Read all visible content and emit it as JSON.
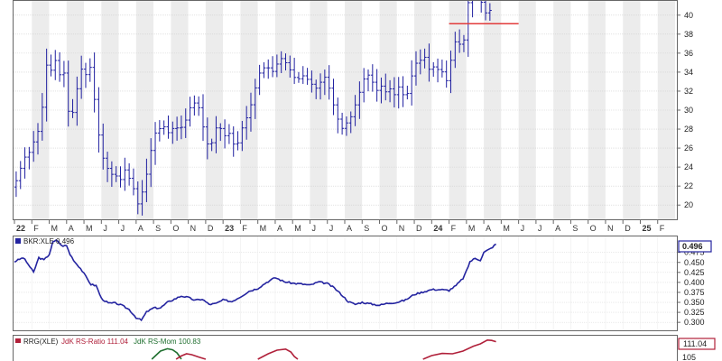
{
  "chart_data": [
    {
      "panel": "price",
      "type": "ohlc",
      "xlabel": "",
      "ylabel": "",
      "ylim": [
        18.5,
        41.5
      ],
      "y_ticks": [
        "20",
        "22",
        "24",
        "26",
        "28",
        "30",
        "32",
        "34",
        "36",
        "38",
        "40"
      ],
      "grid": true,
      "month_labels": [
        "22",
        "F",
        "M",
        "A",
        "M",
        "J",
        "J",
        "A",
        "S",
        "O",
        "N",
        "D",
        "23",
        "F",
        "M",
        "A",
        "M",
        "J",
        "J",
        "A",
        "S",
        "O",
        "N",
        "D",
        "24",
        "F",
        "M",
        "A",
        "M",
        "J",
        "J",
        "A",
        "S",
        "O",
        "N",
        "D",
        "25",
        "F"
      ],
      "bold_labels": [
        "22",
        "23",
        "24",
        "25"
      ],
      "x_range_months": [
        0,
        38
      ],
      "series_keypoints": [
        [
          0.1,
          21.9
        ],
        [
          0.4,
          23.5
        ],
        [
          0.7,
          25.0
        ],
        [
          1.0,
          25.6
        ],
        [
          1.3,
          27.0
        ],
        [
          1.6,
          28.3
        ],
        [
          1.8,
          31.5
        ],
        [
          2.0,
          35.2
        ],
        [
          2.2,
          34.0
        ],
        [
          2.4,
          35.6
        ],
        [
          2.6,
          34.6
        ],
        [
          2.8,
          33.2
        ],
        [
          3.0,
          34.0
        ],
        [
          3.2,
          30.0
        ],
        [
          3.4,
          29.0
        ],
        [
          3.6,
          31.0
        ],
        [
          3.8,
          33.0
        ],
        [
          4.0,
          34.5
        ],
        [
          4.2,
          33.5
        ],
        [
          4.4,
          35.4
        ],
        [
          4.6,
          33.0
        ],
        [
          4.8,
          30.0
        ],
        [
          5.0,
          27.0
        ],
        [
          5.2,
          25.0
        ],
        [
          5.4,
          24.5
        ],
        [
          5.6,
          22.8
        ],
        [
          5.8,
          23.5
        ],
        [
          6.0,
          23.0
        ],
        [
          6.2,
          22.5
        ],
        [
          6.4,
          24.0
        ],
        [
          6.6,
          23.2
        ],
        [
          6.8,
          22.6
        ],
        [
          7.0,
          21.6
        ],
        [
          7.2,
          20.0
        ],
        [
          7.4,
          21.0
        ],
        [
          7.6,
          22.0
        ],
        [
          7.8,
          24.0
        ],
        [
          8.0,
          26.0
        ],
        [
          8.2,
          27.5
        ],
        [
          8.4,
          28.2
        ],
        [
          8.6,
          27.8
        ],
        [
          8.8,
          28.5
        ],
        [
          9.0,
          27.5
        ],
        [
          9.2,
          28.0
        ],
        [
          9.4,
          28.5
        ],
        [
          9.6,
          27.5
        ],
        [
          9.8,
          28.6
        ],
        [
          10.0,
          29.0
        ],
        [
          10.2,
          30.2
        ],
        [
          10.4,
          30.6
        ],
        [
          10.6,
          31.0
        ],
        [
          10.8,
          29.8
        ],
        [
          11.0,
          28.0
        ],
        [
          11.2,
          26.5
        ],
        [
          11.4,
          26.0
        ],
        [
          11.6,
          27.5
        ],
        [
          11.8,
          28.5
        ],
        [
          12.0,
          28.0
        ],
        [
          12.2,
          27.2
        ],
        [
          12.4,
          28.0
        ],
        [
          12.6,
          26.8
        ],
        [
          12.8,
          26.2
        ],
        [
          13.0,
          26.6
        ],
        [
          13.2,
          28.0
        ],
        [
          13.4,
          29.0
        ],
        [
          13.6,
          29.5
        ],
        [
          13.8,
          31.2
        ],
        [
          14.0,
          32.5
        ],
        [
          14.2,
          33.8
        ],
        [
          14.4,
          34.6
        ],
        [
          14.6,
          34.2
        ],
        [
          14.8,
          34.6
        ],
        [
          15.0,
          34.0
        ],
        [
          15.2,
          34.8
        ],
        [
          15.4,
          35.2
        ],
        [
          15.6,
          35.8
        ],
        [
          15.8,
          34.5
        ],
        [
          16.0,
          34.2
        ],
        [
          16.2,
          33.5
        ],
        [
          16.4,
          33.0
        ],
        [
          16.6,
          33.8
        ],
        [
          16.8,
          33.5
        ],
        [
          17.0,
          33.2
        ],
        [
          17.2,
          32.8
        ],
        [
          17.4,
          32.2
        ],
        [
          17.6,
          32.5
        ],
        [
          17.8,
          33.2
        ],
        [
          18.0,
          33.5
        ],
        [
          18.2,
          32.5
        ],
        [
          18.4,
          31.0
        ],
        [
          18.6,
          29.8
        ],
        [
          18.8,
          28.6
        ],
        [
          19.0,
          28.0
        ],
        [
          19.2,
          28.6
        ],
        [
          19.4,
          29.0
        ],
        [
          19.6,
          29.8
        ],
        [
          19.8,
          31.0
        ],
        [
          20.0,
          32.0
        ],
        [
          20.2,
          33.2
        ],
        [
          20.4,
          33.8
        ],
        [
          20.6,
          33.5
        ],
        [
          20.8,
          32.6
        ],
        [
          21.0,
          32.0
        ],
        [
          21.2,
          32.6
        ],
        [
          21.4,
          32.0
        ],
        [
          21.6,
          31.8
        ],
        [
          21.8,
          32.5
        ],
        [
          22.0,
          31.5
        ],
        [
          22.2,
          32.5
        ],
        [
          22.4,
          32.0
        ],
        [
          22.6,
          31.0
        ],
        [
          22.8,
          32.2
        ],
        [
          23.0,
          33.8
        ],
        [
          23.2,
          35.0
        ],
        [
          23.4,
          34.5
        ],
        [
          23.6,
          36.5
        ],
        [
          23.8,
          35.0
        ],
        [
          24.0,
          34.2
        ],
        [
          24.2,
          34.6
        ],
        [
          24.4,
          34.2
        ],
        [
          24.6,
          34.4
        ],
        [
          24.8,
          33.8
        ],
        [
          25.0,
          33.0
        ],
        [
          25.2,
          35.0
        ],
        [
          25.4,
          37.0
        ],
        [
          25.6,
          37.5
        ],
        [
          25.8,
          36.6
        ],
        [
          26.0,
          37.5
        ],
        [
          26.2,
          41.0
        ],
        [
          26.4,
          43.5
        ],
        [
          26.6,
          44.0
        ],
        [
          26.8,
          42.5
        ],
        [
          27.0,
          41.2
        ],
        [
          27.2,
          40.2
        ],
        [
          27.4,
          40.5
        ]
      ],
      "reference_line": {
        "y": 39.1,
        "x0": 25.0,
        "x1": 29.0,
        "color": "#e23b3b"
      },
      "color": "#2020a0",
      "background_stripes": "alternating months"
    },
    {
      "panel": "ratio",
      "type": "line",
      "series": [
        {
          "name": "BKR:XLE",
          "last": "0.496"
        }
      ],
      "ylim": [
        0.28,
        0.515
      ],
      "y_ticks": [
        "0.300",
        "0.325",
        "0.350",
        "0.375",
        "0.400",
        "0.425",
        "0.450",
        "0.475"
      ],
      "last_value": "0.496",
      "color": "#2424a0",
      "keypoints": [
        [
          0.0,
          0.452
        ],
        [
          0.5,
          0.462
        ],
        [
          0.8,
          0.445
        ],
        [
          1.1,
          0.425
        ],
        [
          1.4,
          0.462
        ],
        [
          1.7,
          0.456
        ],
        [
          2.0,
          0.47
        ],
        [
          2.2,
          0.5
        ],
        [
          2.45,
          0.506
        ],
        [
          2.7,
          0.492
        ],
        [
          3.0,
          0.492
        ],
        [
          3.2,
          0.47
        ],
        [
          3.5,
          0.45
        ],
        [
          3.8,
          0.435
        ],
        [
          4.1,
          0.415
        ],
        [
          4.4,
          0.395
        ],
        [
          4.7,
          0.392
        ],
        [
          5.0,
          0.36
        ],
        [
          5.4,
          0.348
        ],
        [
          5.8,
          0.348
        ],
        [
          6.2,
          0.342
        ],
        [
          6.6,
          0.332
        ],
        [
          7.0,
          0.312
        ],
        [
          7.3,
          0.305
        ],
        [
          7.6,
          0.326
        ],
        [
          8.0,
          0.336
        ],
        [
          8.4,
          0.336
        ],
        [
          8.8,
          0.35
        ],
        [
          9.2,
          0.358
        ],
        [
          9.6,
          0.366
        ],
        [
          10.0,
          0.362
        ],
        [
          10.4,
          0.355
        ],
        [
          10.8,
          0.358
        ],
        [
          11.2,
          0.345
        ],
        [
          11.6,
          0.347
        ],
        [
          12.0,
          0.356
        ],
        [
          12.5,
          0.352
        ],
        [
          13.0,
          0.364
        ],
        [
          13.5,
          0.378
        ],
        [
          14.0,
          0.385
        ],
        [
          14.5,
          0.4
        ],
        [
          15.0,
          0.412
        ],
        [
          15.5,
          0.402
        ],
        [
          16.0,
          0.398
        ],
        [
          16.5,
          0.396
        ],
        [
          17.0,
          0.393
        ],
        [
          17.5,
          0.401
        ],
        [
          18.0,
          0.397
        ],
        [
          18.4,
          0.386
        ],
        [
          18.8,
          0.37
        ],
        [
          19.2,
          0.352
        ],
        [
          19.6,
          0.345
        ],
        [
          20.0,
          0.35
        ],
        [
          20.5,
          0.346
        ],
        [
          21.0,
          0.343
        ],
        [
          21.5,
          0.348
        ],
        [
          22.0,
          0.35
        ],
        [
          22.5,
          0.356
        ],
        [
          23.0,
          0.37
        ],
        [
          23.5,
          0.376
        ],
        [
          24.0,
          0.382
        ],
        [
          24.5,
          0.382
        ],
        [
          25.0,
          0.38
        ],
        [
          25.4,
          0.392
        ],
        [
          25.8,
          0.41
        ],
        [
          26.0,
          0.428
        ],
        [
          26.2,
          0.452
        ],
        [
          26.5,
          0.46
        ],
        [
          26.8,
          0.456
        ],
        [
          27.0,
          0.475
        ],
        [
          27.2,
          0.48
        ],
        [
          27.4,
          0.485
        ],
        [
          27.7,
          0.496
        ]
      ]
    },
    {
      "panel": "rrg",
      "type": "line",
      "header_text": "RRG(XLE)",
      "series": [
        {
          "name": "JdK RS-Ratio",
          "label_value": "111.04",
          "color": "#b0203a"
        },
        {
          "name": "JdK RS-Mom",
          "label_value": "100.83",
          "color": "#1f6f2f"
        }
      ],
      "last_value": "111.04",
      "visible_partial_tick": "105",
      "ylim": [
        102,
        116
      ],
      "keypoints_ratio": [
        [
          9.3,
          103.0
        ],
        [
          9.6,
          104.8
        ],
        [
          9.9,
          106.0
        ],
        [
          10.2,
          105.5
        ],
        [
          10.6,
          104.2
        ],
        [
          11.0,
          103.0
        ],
        [
          14.0,
          103.0
        ],
        [
          14.6,
          106.0
        ],
        [
          15.1,
          108.0
        ],
        [
          15.6,
          108.6
        ],
        [
          15.9,
          107.0
        ],
        [
          16.1,
          104.5
        ],
        [
          16.3,
          103.0
        ],
        [
          23.5,
          103.0
        ],
        [
          24.0,
          105.0
        ],
        [
          24.6,
          106.2
        ],
        [
          25.2,
          106.0
        ],
        [
          25.8,
          107.5
        ],
        [
          26.4,
          110.2
        ],
        [
          26.8,
          111.5
        ],
        [
          27.2,
          113.6
        ],
        [
          27.45,
          113.4
        ],
        [
          27.7,
          112.7
        ]
      ],
      "keypoints_mom": [
        [
          7.9,
          103.0
        ],
        [
          8.4,
          107.5
        ],
        [
          8.8,
          108.8
        ],
        [
          9.1,
          108.2
        ],
        [
          9.35,
          106.5
        ],
        [
          9.5,
          104.5
        ],
        [
          9.6,
          103.0
        ]
      ]
    }
  ]
}
